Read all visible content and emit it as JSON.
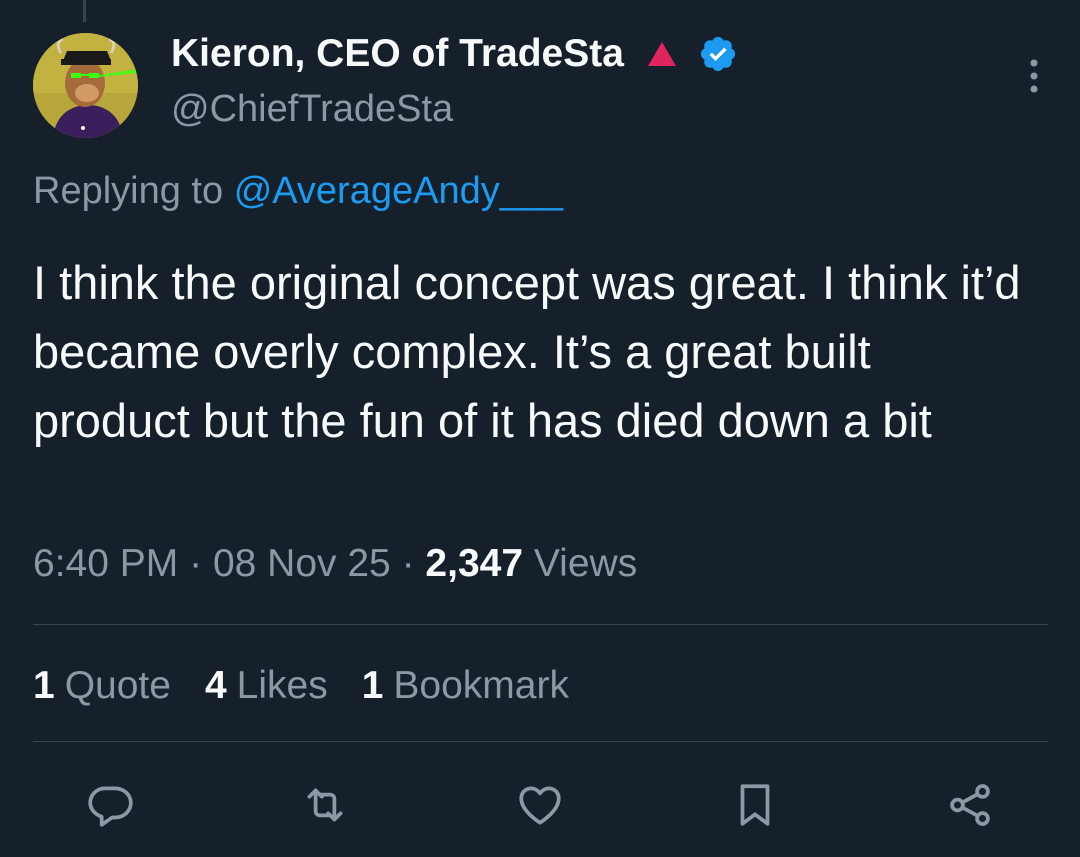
{
  "author": {
    "display_name": "Kieron, CEO of TradeSta",
    "handle": "@ChiefTradeSta",
    "avatar_icon": "ape-avatar-icon",
    "badge_icon": "red-triangle-icon",
    "verified_icon": "verified-check-icon"
  },
  "reply": {
    "prefix": "Replying to",
    "target": "@AverageAndy___"
  },
  "tweet": {
    "text": "I think the original concept was great. I think it’d became overly complex. It’s a great built product but the fun of it has died down a bit"
  },
  "meta": {
    "time": "6:40 PM",
    "separator": "·",
    "date": "08 Nov 25",
    "views_count": "2,347",
    "views_label": "Views"
  },
  "stats": [
    {
      "count": "1",
      "label": "Quote"
    },
    {
      "count": "4",
      "label": "Likes"
    },
    {
      "count": "1",
      "label": "Bookmark"
    }
  ],
  "actions": [
    {
      "name": "reply",
      "icon": "reply-icon"
    },
    {
      "name": "retweet",
      "icon": "retweet-icon"
    },
    {
      "name": "like",
      "icon": "heart-icon"
    },
    {
      "name": "bookmark",
      "icon": "bookmark-icon"
    },
    {
      "name": "share",
      "icon": "share-icon"
    }
  ],
  "colors": {
    "background": "#15202b",
    "text_primary": "#f7f9f9",
    "text_secondary": "#8b98a5",
    "link": "#1d9bf0",
    "divider": "#38444d",
    "badge_red": "#e0245e"
  }
}
